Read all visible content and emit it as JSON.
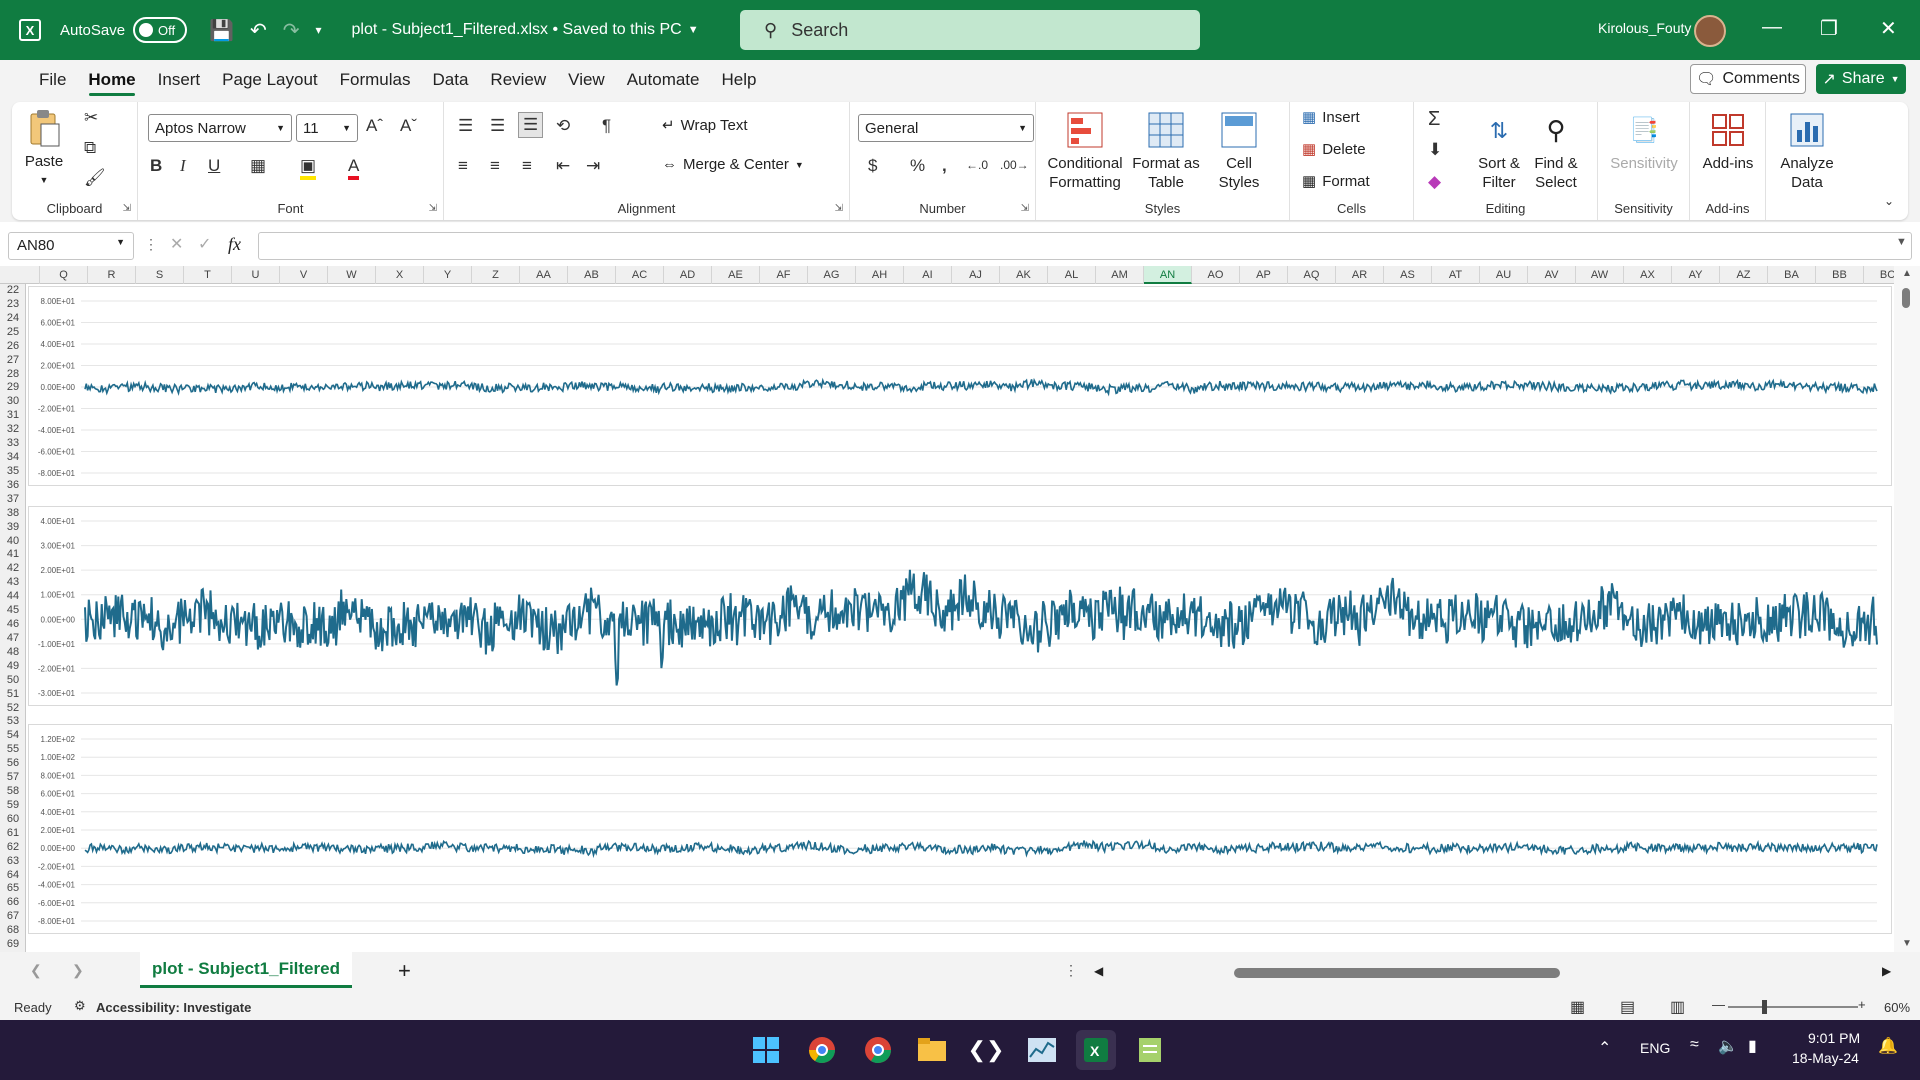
{
  "titlebar": {
    "autosave_label": "AutoSave",
    "autosave_state": "Off",
    "document_title": "plot - Subject1_Filtered.xlsx • Saved to this PC",
    "search_placeholder": "Search",
    "user_name": "Kirolous_Fouty"
  },
  "menu": {
    "tabs": [
      "File",
      "Home",
      "Insert",
      "Page Layout",
      "Formulas",
      "Data",
      "Review",
      "View",
      "Automate",
      "Help"
    ],
    "active_tab": "Home",
    "comments_label": "Comments",
    "share_label": "Share"
  },
  "ribbon": {
    "clipboard": {
      "paste": "Paste",
      "group": "Clipboard"
    },
    "font": {
      "name": "Aptos Narrow",
      "size": "11",
      "group": "Font"
    },
    "alignment": {
      "wrap": "Wrap Text",
      "merge": "Merge & Center",
      "group": "Alignment"
    },
    "number": {
      "format": "General",
      "group": "Number"
    },
    "styles": {
      "conditional": [
        "Conditional",
        "Formatting"
      ],
      "format_table": [
        "Format as",
        "Table"
      ],
      "cell_styles": [
        "Cell",
        "Styles"
      ],
      "group": "Styles"
    },
    "cells": {
      "insert": "Insert",
      "delete": "Delete",
      "format": "Format",
      "group": "Cells"
    },
    "editing": {
      "sort": [
        "Sort &",
        "Filter"
      ],
      "find": [
        "Find &",
        "Select"
      ],
      "group": "Editing"
    },
    "sensitivity": {
      "label": "Sensitivity",
      "group": "Sensitivity"
    },
    "addins": {
      "label": "Add-ins",
      "group": "Add-ins"
    },
    "analyze": {
      "label": [
        "Analyze",
        "Data"
      ]
    }
  },
  "formula_bar": {
    "name_box": "AN80",
    "fx": "fx",
    "value": ""
  },
  "columns": [
    "Q",
    "R",
    "S",
    "T",
    "U",
    "V",
    "W",
    "X",
    "Y",
    "Z",
    "AA",
    "AB",
    "AC",
    "AD",
    "AE",
    "AF",
    "AG",
    "AH",
    "AI",
    "AJ",
    "AK",
    "AL",
    "AM",
    "AN",
    "AO",
    "AP",
    "AQ",
    "AR",
    "AS",
    "AT",
    "AU",
    "AV",
    "AW",
    "AX",
    "AY",
    "AZ",
    "BA",
    "BB",
    "BC"
  ],
  "active_column": "AN",
  "rows": [
    "22",
    "23",
    "24",
    "25",
    "26",
    "27",
    "28",
    "29",
    "30",
    "31",
    "32",
    "33",
    "34",
    "35",
    "36",
    "37",
    "38",
    "39",
    "40",
    "41",
    "42",
    "43",
    "44",
    "45",
    "46",
    "47",
    "48",
    "49",
    "50",
    "51",
    "52",
    "53",
    "54",
    "55",
    "56",
    "57",
    "58",
    "59",
    "60",
    "61",
    "62",
    "63",
    "64",
    "65",
    "66",
    "67",
    "68",
    "69"
  ],
  "chart_data": [
    {
      "type": "line",
      "y_ticks": [
        "8.00E+01",
        "6.00E+01",
        "4.00E+01",
        "2.00E+01",
        "0.00E+00",
        "-2.00E+01",
        "-4.00E+01",
        "-6.00E+01",
        "-8.00E+01"
      ],
      "ylim": [
        -80,
        80
      ],
      "x_range": [
        1,
        20000
      ],
      "series_color": "#1f6b8c",
      "amplitude": 5,
      "grid": true
    },
    {
      "type": "line",
      "y_ticks": [
        "4.00E+01",
        "3.00E+01",
        "2.00E+01",
        "1.00E+01",
        "0.00E+00",
        "-1.00E+01",
        "-2.00E+01",
        "-3.00E+01"
      ],
      "ylim": [
        -30,
        40
      ],
      "x_range": [
        1,
        20000
      ],
      "series_color": "#1f6b8c",
      "amplitude": 12,
      "grid": true
    },
    {
      "type": "line",
      "y_ticks": [
        "1.20E+02",
        "1.00E+02",
        "8.00E+01",
        "6.00E+01",
        "4.00E+01",
        "2.00E+01",
        "0.00E+00",
        "-2.00E+01",
        "-4.00E+01",
        "-6.00E+01",
        "-8.00E+01"
      ],
      "ylim": [
        -80,
        120
      ],
      "x_range": [
        1,
        20000
      ],
      "series_color": "#1f6b8c",
      "amplitude": 6,
      "grid": true
    }
  ],
  "sheet": {
    "name": "plot - Subject1_Filtered",
    "add": "+"
  },
  "status": {
    "ready": "Ready",
    "accessibility": "Accessibility: Investigate",
    "zoom": "60%"
  },
  "taskbar": {
    "lang": "ENG",
    "time": "9:01 PM",
    "date": "18-May-24"
  }
}
